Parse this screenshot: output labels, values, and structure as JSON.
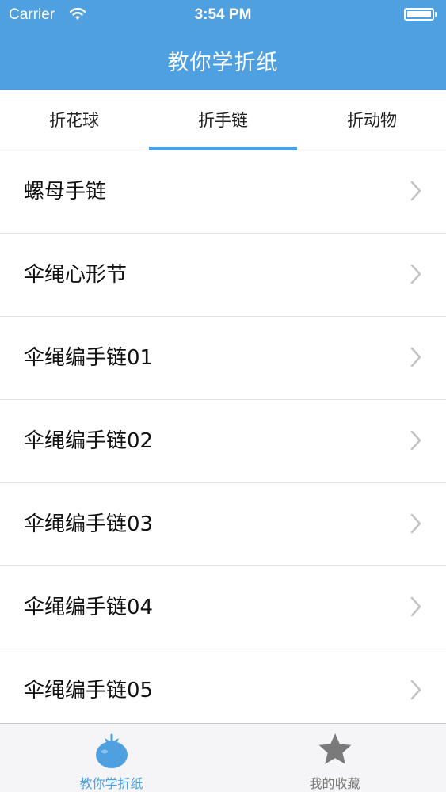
{
  "status_bar": {
    "carrier": "Carrier",
    "time": "3:54 PM"
  },
  "nav": {
    "title": "教你学折纸"
  },
  "tabs": [
    {
      "label": "折花球",
      "selected": false
    },
    {
      "label": "折手链",
      "selected": true
    },
    {
      "label": "折动物",
      "selected": false
    }
  ],
  "list": {
    "items": [
      {
        "label": "螺母手链"
      },
      {
        "label": "伞绳心形节"
      },
      {
        "label": "伞绳编手链01"
      },
      {
        "label": "伞绳编手链02"
      },
      {
        "label": "伞绳编手链03"
      },
      {
        "label": "伞绳编手链04"
      },
      {
        "label": "伞绳编手链05"
      }
    ]
  },
  "tab_bar": {
    "items": [
      {
        "label": "教你学折纸",
        "icon": "tomato-icon",
        "selected": true
      },
      {
        "label": "我的收藏",
        "icon": "star-icon",
        "selected": false
      }
    ]
  },
  "colors": {
    "accent": "#4fa0e1",
    "inactive": "#7a7a7a"
  }
}
